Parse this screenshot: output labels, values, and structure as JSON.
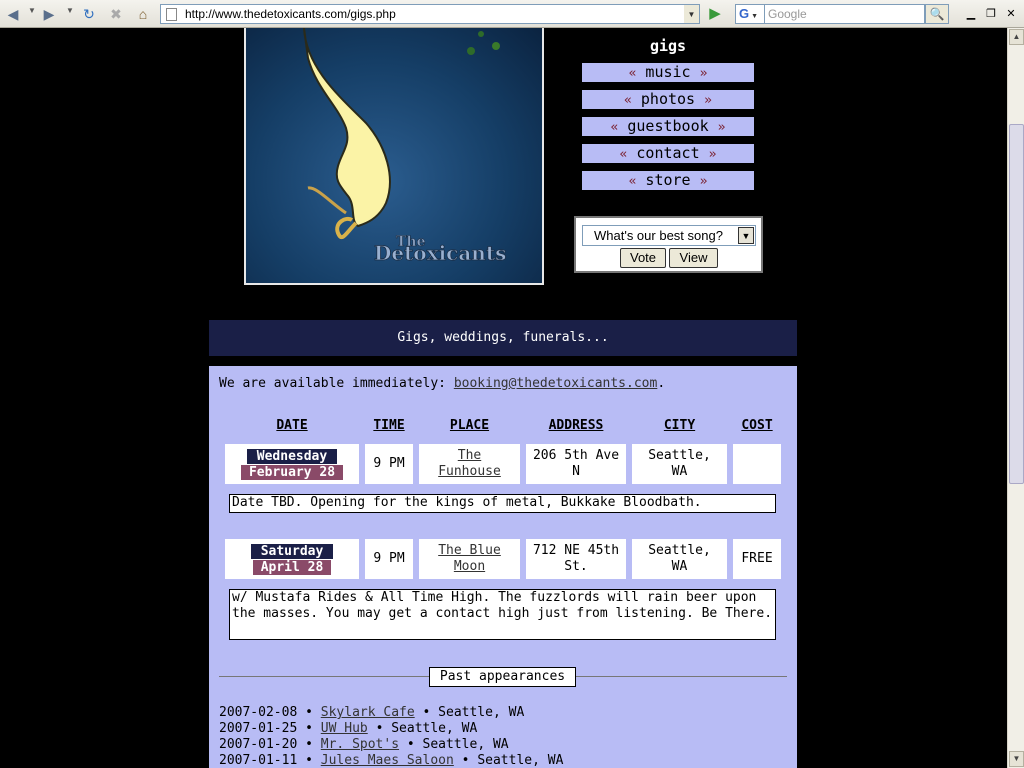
{
  "browser": {
    "url": "http://www.thedetoxicants.com/gigs.php",
    "search_engine": "G",
    "search_placeholder": "Google"
  },
  "nav": {
    "title": "gigs",
    "items": [
      {
        "label": "« music »",
        "left": "«",
        "text": "music",
        "right": "»"
      },
      {
        "label": "« photos »",
        "left": "«",
        "text": "photos",
        "right": "»"
      },
      {
        "label": "« guestbook »",
        "left": "«",
        "text": "guestbook",
        "right": "»"
      },
      {
        "label": "« contact »",
        "left": "«",
        "text": "contact",
        "right": "»"
      },
      {
        "label": "« store »",
        "left": "«",
        "text": "store",
        "right": "»"
      }
    ]
  },
  "banner": {
    "logo_text": "The Detoxicants"
  },
  "poll": {
    "selected": "What's our best song?",
    "vote_label": "Vote",
    "view_label": "View"
  },
  "gigs": {
    "header": "Gigs, weddings, funerals...",
    "intro": "We are available immediately: ",
    "email": "booking@thedetoxicants.com",
    "intro_end": ".",
    "columns": [
      "DATE",
      "TIME",
      "PLACE",
      "ADDRESS",
      "CITY",
      "COST"
    ],
    "rows": [
      {
        "day": "Wednesday",
        "date": "February 28",
        "time": "9 PM",
        "place": "The Funhouse",
        "address": "206 5th Ave N",
        "city": "Seattle, WA",
        "cost": "",
        "note": "Date TBD. Opening for the kings of metal, Bukkake Bloodbath."
      },
      {
        "day": "Saturday",
        "date": "April 28",
        "time": "9 PM",
        "place": "The Blue Moon",
        "address": "712 NE 45th St.",
        "city": "Seattle, WA",
        "cost": "FREE",
        "note": "w/ Mustafa Rides & All Time High. The fuzzlords will rain beer upon the masses. You may get a contact high just from listening. Be There."
      }
    ]
  },
  "past": {
    "label": "Past appearances",
    "items": [
      {
        "date": "2007-02-08",
        "venue": "Skylark Cafe",
        "city": "Seattle, WA"
      },
      {
        "date": "2007-01-25",
        "venue": "UW Hub",
        "city": "Seattle, WA"
      },
      {
        "date": "2007-01-20",
        "venue": "Mr. Spot's",
        "city": "Seattle, WA"
      },
      {
        "date": "2007-01-11",
        "venue": "Jules Maes Saloon",
        "city": "Seattle, WA"
      }
    ],
    "separator": "•"
  }
}
